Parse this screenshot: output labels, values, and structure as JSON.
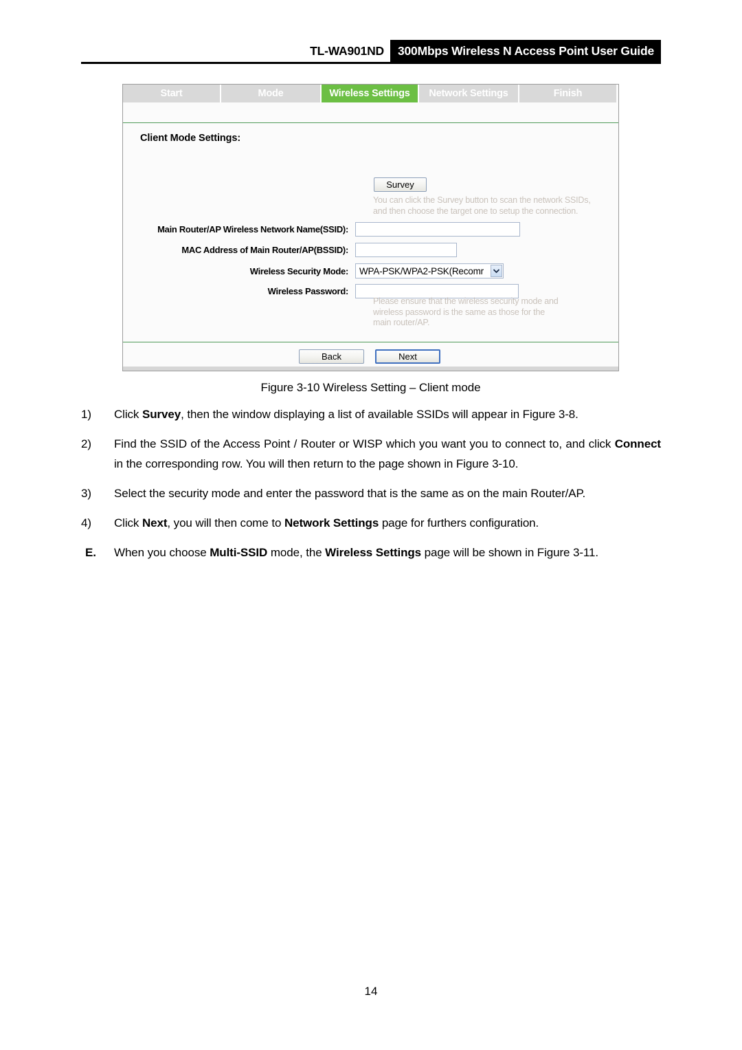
{
  "header": {
    "model": "TL-WA901ND",
    "title": "300Mbps Wireless N Access Point User Guide"
  },
  "figure": {
    "tabs": [
      {
        "label": "Start",
        "active": false
      },
      {
        "label": "Mode",
        "active": false
      },
      {
        "label": "Wireless Settings",
        "active": true
      },
      {
        "label": "Network Settings",
        "active": false
      },
      {
        "label": "Finish",
        "active": false
      }
    ],
    "section_title": "Client Mode Settings:",
    "survey_button": "Survey",
    "survey_hint": "You can click the Survey button to scan the network SSIDs,\nand then choose the target one to setup the connection.",
    "fields": {
      "ssid_label": "Main Router/AP Wireless Network Name(SSID):",
      "ssid_value": "",
      "bssid_label": "MAC Address of Main Router/AP(BSSID):",
      "bssid_value": "",
      "security_mode_label": "Wireless Security Mode:",
      "security_mode_value": "WPA-PSK/WPA2-PSK(Recomr",
      "password_label": "Wireless Password:",
      "password_value": ""
    },
    "password_hint": "Please ensure that the wireless security mode and\nwireless password is the same as those for the\nmain router/AP.",
    "back_button": "Back",
    "next_button": "Next",
    "accent_green": "#6cbf44",
    "tab_inactive_bg": "#d9d9d9"
  },
  "caption": "Figure 3-10 Wireless Setting – Client mode",
  "list": [
    {
      "marker": "1)",
      "parts": [
        {
          "t": "Click ",
          "b": false
        },
        {
          "t": "Survey",
          "b": true
        },
        {
          "t": ", then the window displaying a list of available SSIDs will appear in Figure 3-8.",
          "b": false
        }
      ]
    },
    {
      "marker": "2)",
      "parts": [
        {
          "t": "Find the SSID of the Access Point / Router or WISP which you want you to connect to, and click ",
          "b": false
        },
        {
          "t": "Connect",
          "b": true
        },
        {
          "t": " in the corresponding row. You will then return to the page shown in Figure 3-10.",
          "b": false
        }
      ]
    },
    {
      "marker": "3)",
      "parts": [
        {
          "t": "Select the security mode and enter the password that is the same as on the main Router/AP.",
          "b": false
        }
      ]
    },
    {
      "marker": "4)",
      "parts": [
        {
          "t": "Click ",
          "b": false
        },
        {
          "t": "Next",
          "b": true
        },
        {
          "t": ", you will then come to ",
          "b": false
        },
        {
          "t": "Network Settings",
          "b": true
        },
        {
          "t": " page for furthers configuration.",
          "b": false
        }
      ]
    },
    {
      "marker": "E.",
      "letter": true,
      "parts": [
        {
          "t": "When you choose ",
          "b": false
        },
        {
          "t": "Multi-SSID",
          "b": true
        },
        {
          "t": " mode, the ",
          "b": false
        },
        {
          "t": "Wireless Settings",
          "b": true
        },
        {
          "t": " page will be shown in Figure 3-11.",
          "b": false
        }
      ]
    }
  ],
  "page_number": "14"
}
